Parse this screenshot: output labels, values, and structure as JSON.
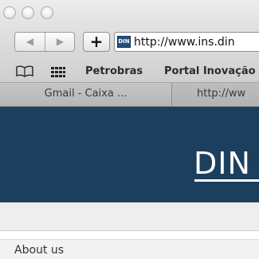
{
  "browser": {
    "url": "http://www.ins.din",
    "favicon_label": "DIN",
    "nav": {
      "back_glyph": "◀",
      "forward_glyph": "▶",
      "add_glyph": "+"
    },
    "bookmarks": [
      "Petrobras",
      "Portal Inovação"
    ],
    "bookmark_icons": [
      "book-icon",
      "grid-icon"
    ],
    "tabs": [
      {
        "label": "Gmail - Caixa ...",
        "active": false
      },
      {
        "label": "http://ww",
        "active": true
      }
    ]
  },
  "page": {
    "logo_text": "DIN",
    "footer_nav": {
      "about_label": "About us"
    }
  },
  "colors": {
    "header_blue": "#1d3f5e",
    "favicon_blue": "#254e7c"
  }
}
